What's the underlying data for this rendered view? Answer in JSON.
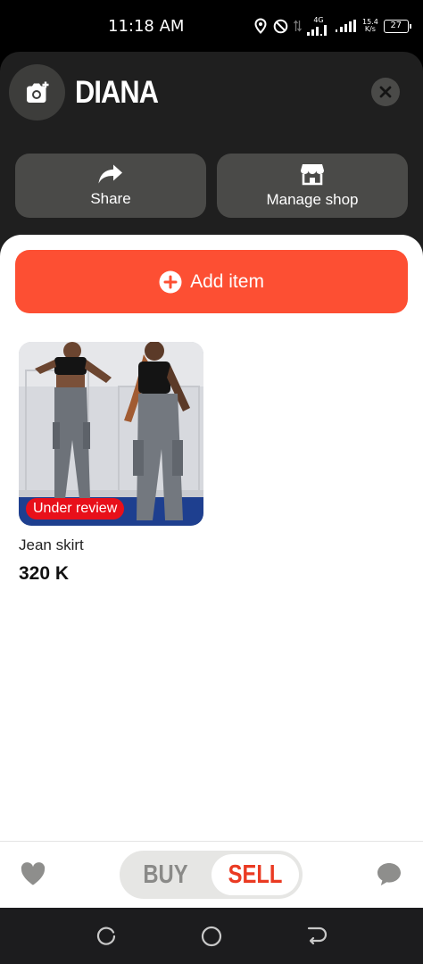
{
  "status_bar": {
    "time": "11:18 AM",
    "network_top": "4G",
    "speed_value": "15.4",
    "speed_unit": "K/s",
    "battery": "27"
  },
  "header": {
    "shop_name": "DIANA",
    "icons": {
      "avatar": "camera-add-icon",
      "close": "close-icon"
    }
  },
  "actions": {
    "share_label": "Share",
    "share_icon": "share-arrow-icon",
    "manage_label": "Manage shop",
    "manage_icon": "shop-icon"
  },
  "sheet": {
    "add_item_label": "Add item",
    "add_item_icon": "plus-circle-icon",
    "items": [
      {
        "name": "Jean skirt",
        "price": "320 K",
        "status": "Under review"
      }
    ]
  },
  "bottom_bar": {
    "buy_label": "BUY",
    "sell_label": "SELL",
    "selected": "SELL",
    "icons": {
      "left": "heart-icon",
      "right": "chat-bubble-icon"
    }
  },
  "nav": {
    "icons": [
      "recent-apps-icon",
      "home-icon",
      "back-icon"
    ]
  },
  "colors": {
    "accent": "#fd4f33",
    "badge": "#e8101a",
    "sell_text": "#ea3a22",
    "dark_bg": "#1f1f1f",
    "button_gray": "#4a4a48"
  }
}
